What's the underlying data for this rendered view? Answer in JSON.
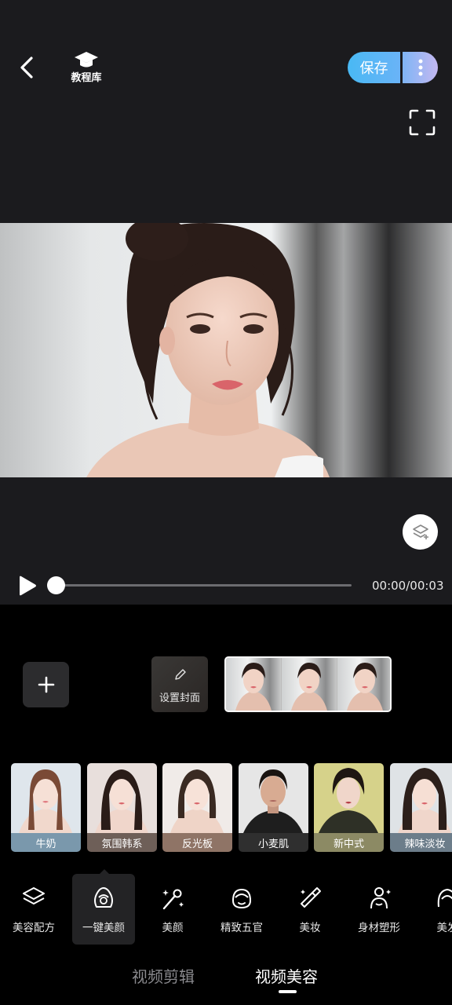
{
  "header": {
    "tutorial_label": "教程库",
    "save_label": "保存"
  },
  "player": {
    "time": "00:00/00:03",
    "progress": 0
  },
  "timeline": {
    "cover_label": "设置封面",
    "frames": 3
  },
  "filters": [
    {
      "name": "牛奶",
      "label_bg": "#7a98ac"
    },
    {
      "name": "氛围韩系",
      "label_bg": "#6e5f58"
    },
    {
      "name": "反光板",
      "label_bg": "#8f7466"
    },
    {
      "name": "小麦肌",
      "label_bg": "#2f2f2f"
    },
    {
      "name": "新中式",
      "label_bg": "#8c8a64"
    },
    {
      "name": "辣味淡妆",
      "label_bg": "#6c7d8a"
    }
  ],
  "tools": [
    {
      "label": "美容配方",
      "icon": "layers-icon"
    },
    {
      "label": "一键美颜",
      "icon": "face-outline-icon",
      "active": true
    },
    {
      "label": "美颜",
      "icon": "magic-wand-icon"
    },
    {
      "label": "精致五官",
      "icon": "face-smile-icon"
    },
    {
      "label": "美妆",
      "icon": "lipstick-icon"
    },
    {
      "label": "身材塑形",
      "icon": "body-shape-icon"
    },
    {
      "label": "美发",
      "icon": "hair-icon"
    }
  ],
  "bottom_tabs": {
    "edit": "视频剪辑",
    "beauty": "视频美容",
    "active": "beauty"
  },
  "colors": {
    "save_gradient_start": "#49b9f4",
    "more_gradient_end": "#c4b8f1",
    "editor_bg": "#1b1b1e"
  }
}
